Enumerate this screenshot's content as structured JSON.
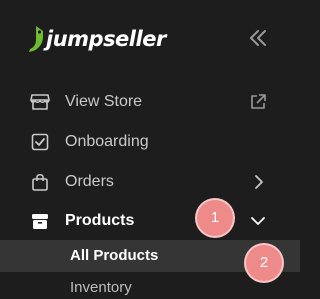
{
  "brand": {
    "name": "jumpseller",
    "accent_color": "#6fbd2e"
  },
  "icons": {
    "collapse": "double-chevron-left-icon",
    "view_store": "store-icon",
    "external_link": "external-link-icon",
    "onboarding": "checkbox-icon",
    "orders": "shopping-bag-icon",
    "orders_expand": "chevron-right-icon",
    "products": "box-icon",
    "products_expand": "chevron-down-icon"
  },
  "nav": {
    "view_store": "View Store",
    "onboarding": "Onboarding",
    "orders": "Orders",
    "products": "Products"
  },
  "products_submenu": {
    "all_products": "All Products",
    "inventory": "Inventory"
  },
  "callouts": {
    "first": "1",
    "second": "2"
  },
  "colors": {
    "background": "#1d1d1d",
    "selected_row": "#353535",
    "callout": "#ee8a8a"
  }
}
